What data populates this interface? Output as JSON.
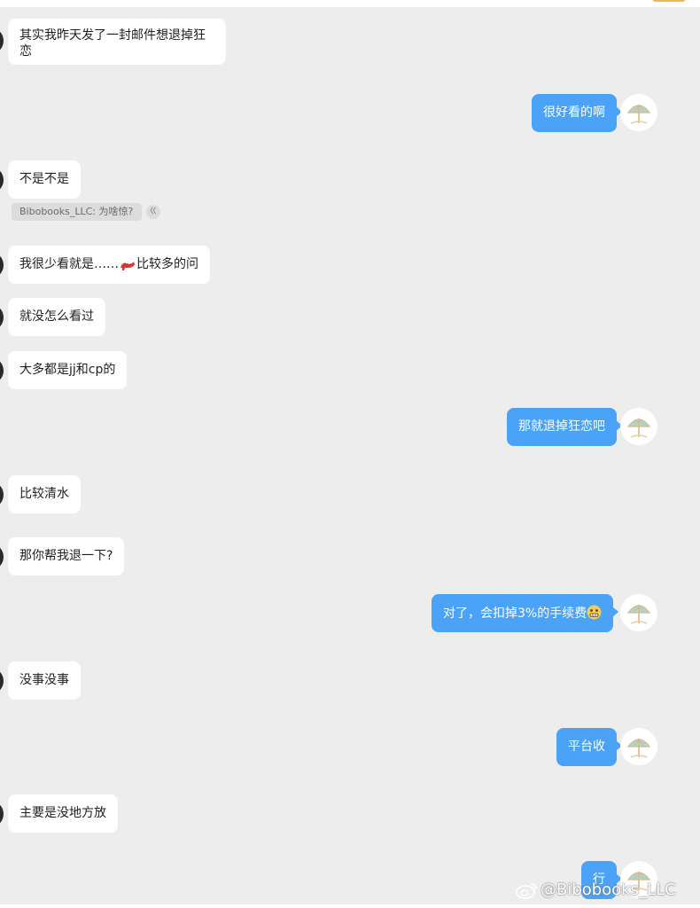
{
  "chat": {
    "messages": [
      {
        "side": "left",
        "text": "其实我昨天发了一封邮件想退掉狂恋"
      },
      {
        "side": "right",
        "text": "很好看的啊"
      },
      {
        "side": "left",
        "text": "不是不是"
      },
      {
        "side": "left",
        "text_before": "我很少看就是……",
        "text_after": "比较多的问",
        "icon": "high-heel-shoe-icon"
      },
      {
        "side": "left",
        "text": "就没怎么看过"
      },
      {
        "side": "left",
        "text": "大多都是jj和cp的"
      },
      {
        "side": "right",
        "text": "那就退掉狂恋吧"
      },
      {
        "side": "left",
        "text": "比较清水"
      },
      {
        "side": "left",
        "text": "那你帮我退一下?"
      },
      {
        "side": "right",
        "text": "对了，会扣掉3%的手续费",
        "icon": "grimace-emoji-icon"
      },
      {
        "side": "left",
        "text": "没事没事"
      },
      {
        "side": "right",
        "text": "平台收"
      },
      {
        "side": "left",
        "text": "主要是没地方放"
      },
      {
        "side": "right",
        "text": "行"
      }
    ],
    "quote": {
      "text": "Bibobooks_LLC: 为啥惊?",
      "close_label": "ㄍ"
    }
  },
  "watermark": {
    "text": "@Bibobooks_LLC"
  },
  "colors": {
    "background": "#ededed",
    "incoming_bubble": "#ffffff",
    "outgoing_bubble": "#4aa3f6",
    "outgoing_text": "#ffffff",
    "incoming_text": "#1f1f1f"
  }
}
